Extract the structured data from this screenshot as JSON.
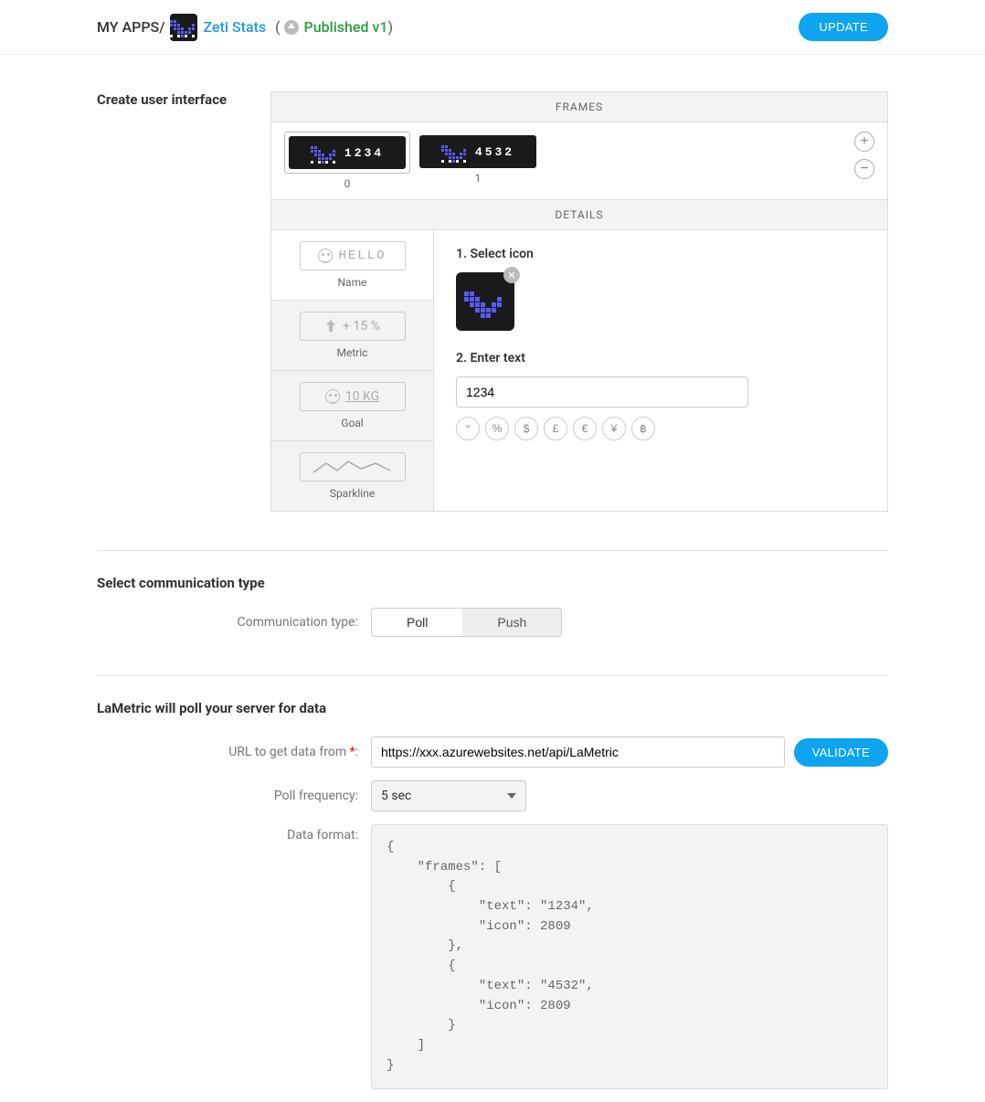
{
  "header": {
    "breadcrumb_root": "MY APPS/",
    "app_name": "Zeti Stats",
    "published_label": "Published v1",
    "update_button": "UPDATE"
  },
  "ui_section": {
    "title": "Create user interface",
    "frames_header": "FRAMES",
    "details_header": "DETAILS",
    "frames": [
      {
        "index": "0",
        "text": "1234",
        "selected": true
      },
      {
        "index": "1",
        "text": "4532",
        "selected": false
      }
    ],
    "frame_types": [
      {
        "key": "name",
        "label": "Name",
        "sample": "HELLO",
        "active": true
      },
      {
        "key": "metric",
        "label": "Metric",
        "sample": "+ 15 %",
        "active": false
      },
      {
        "key": "goal",
        "label": "Goal",
        "sample": "10 KG",
        "active": false
      },
      {
        "key": "sparkline",
        "label": "Sparkline",
        "sample": "",
        "active": false
      }
    ],
    "step1_label": "1. Select icon",
    "step2_label": "2. Enter text",
    "text_value": "1234",
    "symbols": [
      "°",
      "%",
      "$",
      "£",
      "€",
      "¥",
      "฿"
    ]
  },
  "comm_section": {
    "title": "Select communication type",
    "label": "Communication type:",
    "options": {
      "poll": "Poll",
      "push": "Push"
    },
    "selected": "poll"
  },
  "poll_section": {
    "title": "LaMetric will poll your server for data",
    "url_label": "URL to get data from",
    "url_value": "https://xxx.azurewebsites.net/api/LaMetric",
    "validate_button": "VALIDATE",
    "freq_label": "Poll frequency:",
    "freq_value": "5 sec",
    "format_label": "Data format:",
    "format_value": "{\n    \"frames\": [\n        {\n            \"text\": \"1234\",\n            \"icon\": 2809\n        },\n        {\n            \"text\": \"4532\",\n            \"icon\": 2809\n        }\n    ]\n}"
  }
}
